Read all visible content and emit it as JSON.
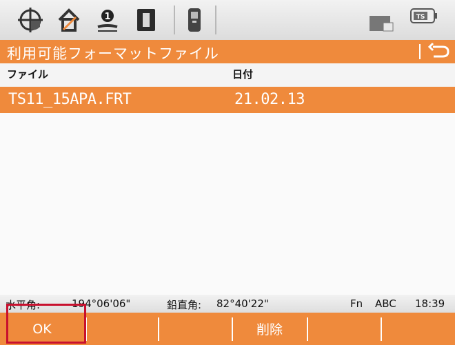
{
  "toolbar": {
    "icons": [
      "crosshair-icon",
      "home-icon",
      "info-icon",
      "instrument-icon",
      "device-icon",
      "battery-icon",
      "ts-badge-icon"
    ],
    "ts_badge": "TS"
  },
  "title": "利用可能フォーマットファイル",
  "columns": {
    "file": "ファイル",
    "date": "日付"
  },
  "rows": [
    {
      "file": "TS11_15APA.FRT",
      "date": "21.02.13",
      "selected": true
    }
  ],
  "status": {
    "hz_label": "水平角:",
    "hz_value": "194°06'06\"",
    "v_label": "鉛直角:",
    "v_value": "82°40'22\"",
    "fn": "Fn",
    "mode": "ABC",
    "time": "18:39"
  },
  "fkeys": {
    "f1": "OK",
    "f2": "",
    "f3": "",
    "f4": "削除",
    "f5": "",
    "f6": ""
  },
  "colors": {
    "accent": "#ef8a3c",
    "highlight": "#c8102e"
  }
}
